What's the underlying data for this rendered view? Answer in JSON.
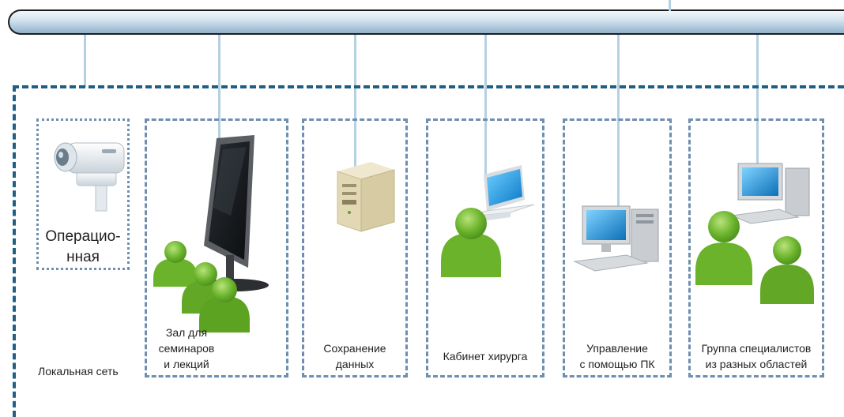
{
  "network": {
    "lan_label": "Локальная сеть"
  },
  "nodes": [
    {
      "id": "operating-room",
      "lines": [
        "Операцио-",
        "нная"
      ],
      "icon": "camera-icon"
    },
    {
      "id": "seminar-hall",
      "lines": [
        "Зал для",
        "семинаров",
        "и лекций"
      ],
      "icon": "monitor-with-people-icon"
    },
    {
      "id": "data-storage",
      "lines": [
        "Сохранение",
        "данных"
      ],
      "icon": "server-icon"
    },
    {
      "id": "surgeon-office",
      "lines": [
        "Кабинет хирурга"
      ],
      "icon": "laptop-with-person-icon"
    },
    {
      "id": "pc-control",
      "lines": [
        "Управление",
        "с помощью ПК"
      ],
      "icon": "desktop-computer-icon"
    },
    {
      "id": "specialists-group",
      "lines": [
        "Группа специалистов",
        "из разных областей"
      ],
      "icon": "computers-with-people-icon"
    }
  ],
  "colors": {
    "bus_border": "#1d1d1d",
    "bus_fill": "#a6c3d8",
    "lan_frame": "#1f5f86",
    "node_border": "#6f8fb0",
    "person_green": "#6ab32b",
    "drop_line": "#b3d1e1"
  }
}
